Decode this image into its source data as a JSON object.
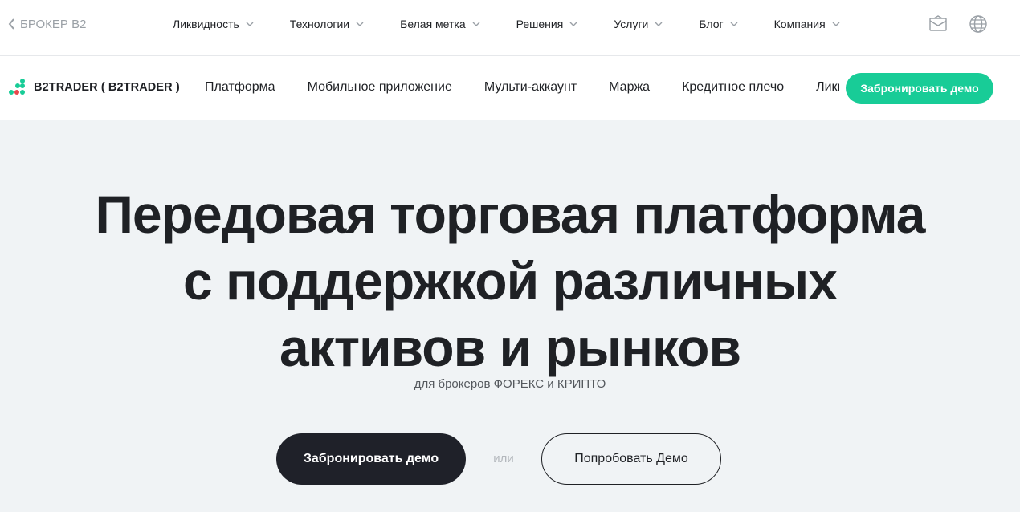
{
  "topbar": {
    "back_label": "БРОКЕР B2",
    "nav": [
      {
        "label": "Ликвидность"
      },
      {
        "label": "Технологии"
      },
      {
        "label": "Белая метка"
      },
      {
        "label": "Решения"
      },
      {
        "label": "Услуги"
      },
      {
        "label": "Блог"
      },
      {
        "label": "Компания"
      }
    ],
    "icons": [
      "mail-icon",
      "globe-icon"
    ]
  },
  "productbar": {
    "brand": "B2TRADER ( B2TRADER )",
    "nav": [
      {
        "label": "Платформа"
      },
      {
        "label": "Мобильное приложение"
      },
      {
        "label": "Мульти-аккаунт"
      },
      {
        "label": "Маржа"
      },
      {
        "label": "Кредитное плечо"
      },
      {
        "label": "Ликвидность"
      }
    ],
    "cta": "Забронировать демо"
  },
  "hero": {
    "title_lines": [
      "Передовая торговая платформа",
      "с поддержкой различных",
      "активов и рынков"
    ],
    "subtitle": "для брокеров ФОРЕКС и КРИПТО",
    "primary_button": "Забронировать демо",
    "or_text": "или",
    "secondary_button": "Попробовать Демо"
  },
  "colors": {
    "accent": "#18cc97",
    "dark": "#1f2129",
    "hero_bg": "#f0f3f5"
  }
}
